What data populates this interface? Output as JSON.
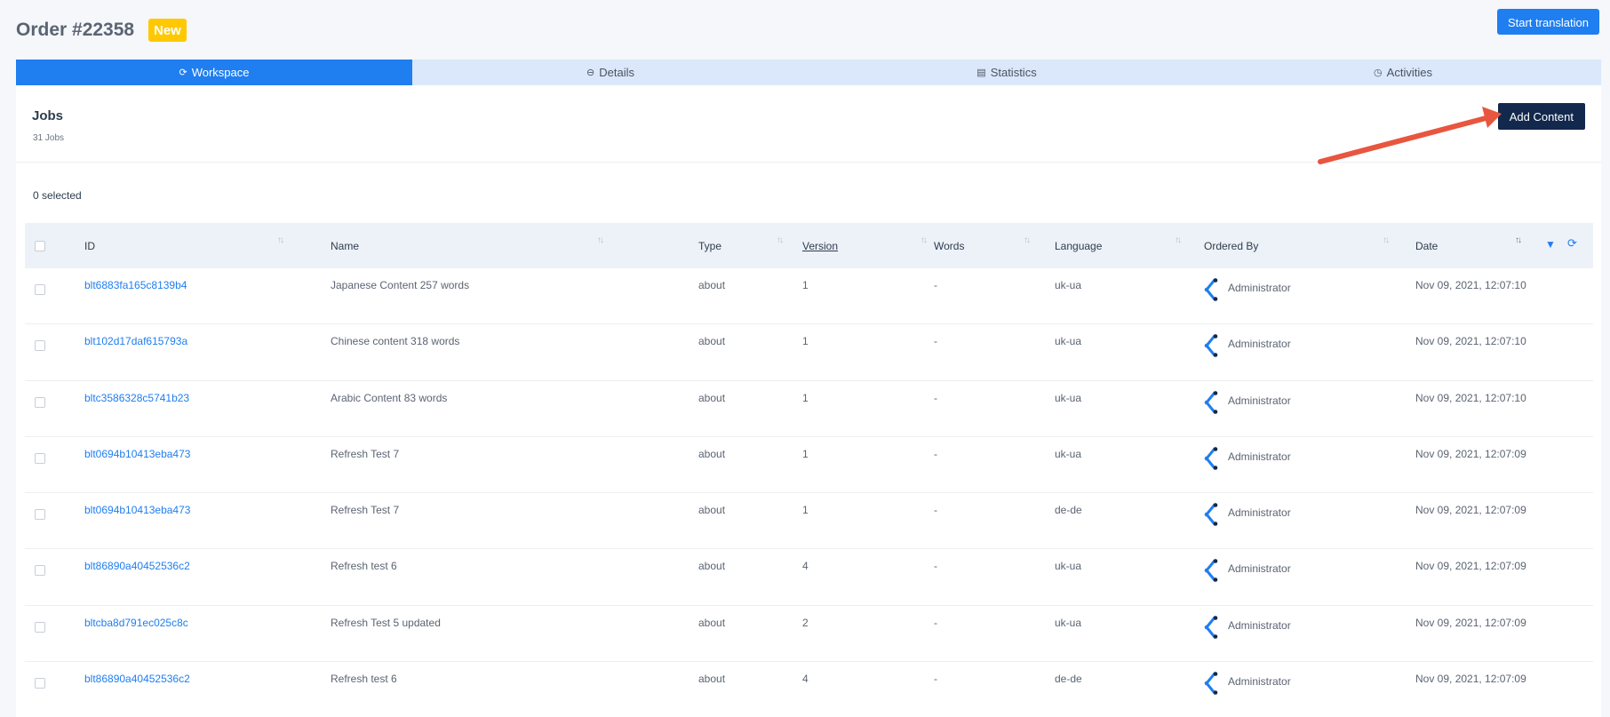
{
  "header": {
    "title": "Order #22358",
    "badge": "New",
    "start_button": "Start translation"
  },
  "tabs": [
    {
      "label": "Workspace",
      "icon": "refresh-icon",
      "glyph": "⟳"
    },
    {
      "label": "Details",
      "icon": "minus-circle-icon",
      "glyph": "⊖"
    },
    {
      "label": "Statistics",
      "icon": "chart-icon",
      "glyph": "▤"
    },
    {
      "label": "Activities",
      "icon": "history-icon",
      "glyph": "◷"
    }
  ],
  "jobs": {
    "title": "Jobs",
    "count": "31 Jobs",
    "add_button": "Add Content",
    "selected": "0 selected"
  },
  "columns": {
    "id": "ID",
    "name": "Name",
    "type": "Type",
    "version": "Version",
    "words": "Words",
    "language": "Language",
    "ordered_by": "Ordered By",
    "date": "Date"
  },
  "rows": [
    {
      "id": "blt6883fa165c8139b4",
      "name": "Japanese Content 257 words",
      "type": "about",
      "version": "1",
      "words": "-",
      "language": "uk-ua",
      "ordered_by": "Administrator",
      "date": "Nov 09, 2021, 12:07:10"
    },
    {
      "id": "blt102d17daf615793a",
      "name": "Chinese content 318 words",
      "type": "about",
      "version": "1",
      "words": "-",
      "language": "uk-ua",
      "ordered_by": "Administrator",
      "date": "Nov 09, 2021, 12:07:10"
    },
    {
      "id": "bltc3586328c5741b23",
      "name": "Arabic Content 83 words",
      "type": "about",
      "version": "1",
      "words": "-",
      "language": "uk-ua",
      "ordered_by": "Administrator",
      "date": "Nov 09, 2021, 12:07:10"
    },
    {
      "id": "blt0694b10413eba473",
      "name": "Refresh Test 7",
      "type": "about",
      "version": "1",
      "words": "-",
      "language": "uk-ua",
      "ordered_by": "Administrator",
      "date": "Nov 09, 2021, 12:07:09"
    },
    {
      "id": "blt0694b10413eba473",
      "name": "Refresh Test 7",
      "type": "about",
      "version": "1",
      "words": "-",
      "language": "de-de",
      "ordered_by": "Administrator",
      "date": "Nov 09, 2021, 12:07:09"
    },
    {
      "id": "blt86890a40452536c2",
      "name": "Refresh test 6",
      "type": "about",
      "version": "4",
      "words": "-",
      "language": "uk-ua",
      "ordered_by": "Administrator",
      "date": "Nov 09, 2021, 12:07:09"
    },
    {
      "id": "bltcba8d791ec025c8c",
      "name": "Refresh Test 5 updated",
      "type": "about",
      "version": "2",
      "words": "-",
      "language": "uk-ua",
      "ordered_by": "Administrator",
      "date": "Nov 09, 2021, 12:07:09"
    },
    {
      "id": "blt86890a40452536c2",
      "name": "Refresh test 6",
      "type": "about",
      "version": "4",
      "words": "-",
      "language": "de-de",
      "ordered_by": "Administrator",
      "date": "Nov 09, 2021, 12:07:09"
    }
  ],
  "colors": {
    "accent": "#1f7ef0",
    "dark_button": "#12284c",
    "badge": "#ffc800",
    "arrow": "#e8563f"
  }
}
